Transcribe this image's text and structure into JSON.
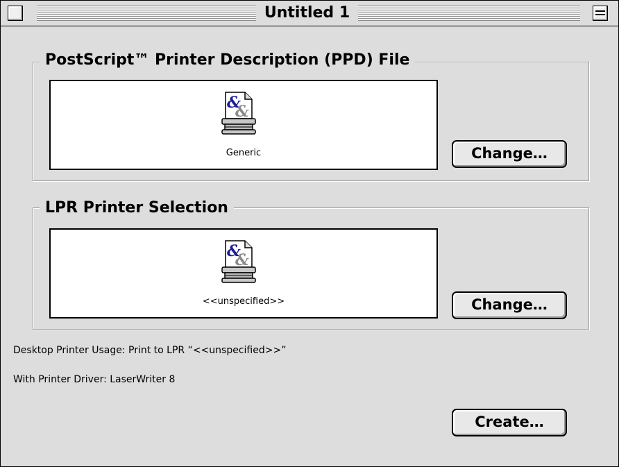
{
  "window": {
    "title": "Untitled 1"
  },
  "ppd_group": {
    "title": "PostScript™ Printer Description (PPD) File",
    "selected_label": "Generic",
    "change_label": "Change…"
  },
  "lpr_group": {
    "title": "LPR Printer Selection",
    "selected_label": "<<unspecified>>",
    "change_label": "Change…"
  },
  "info": {
    "usage": "Desktop Printer Usage: Print to LPR “<<unspecified>>”",
    "driver": "With Printer Driver: LaserWriter 8"
  },
  "create_label": "Create…",
  "colors": {
    "ampersand_front": "#1c1c9a",
    "ampersand_back": "#8a8a8a",
    "window_bg": "#dddddd"
  }
}
